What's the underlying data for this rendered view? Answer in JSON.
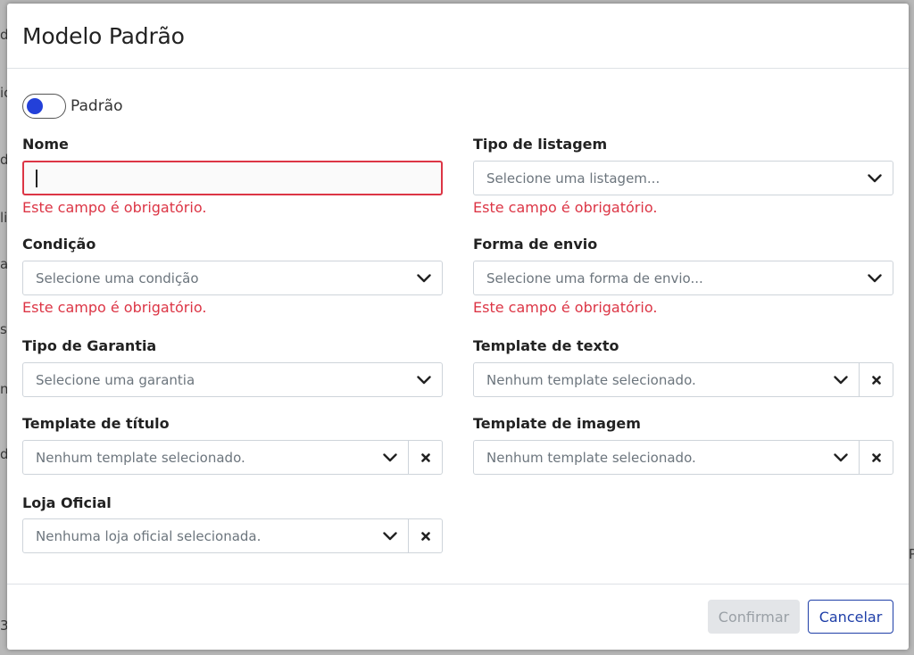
{
  "modal": {
    "title": "Modelo Padrão",
    "toggle_label": "Padrão",
    "toggle_on": false
  },
  "fields": {
    "nome": {
      "label": "Nome",
      "value": "",
      "error": "Este campo é obrigatório."
    },
    "tipo_listagem": {
      "label": "Tipo de listagem",
      "placeholder": "Selecione uma listagem...",
      "error": "Este campo é obrigatório."
    },
    "condicao": {
      "label": "Condição",
      "placeholder": "Selecione uma condição",
      "error": "Este campo é obrigatório."
    },
    "forma_envio": {
      "label": "Forma de envio",
      "placeholder": "Selecione uma forma de envio...",
      "error": "Este campo é obrigatório."
    },
    "tipo_garantia": {
      "label": "Tipo de Garantia",
      "placeholder": "Selecione uma garantia"
    },
    "template_texto": {
      "label": "Template de texto",
      "placeholder": "Nenhum template selecionado."
    },
    "template_titulo": {
      "label": "Template de título",
      "placeholder": "Nenhum template selecionado."
    },
    "template_imagem": {
      "label": "Template de imagem",
      "placeholder": "Nenhum template selecionado."
    },
    "loja_oficial": {
      "label": "Loja Oficial",
      "placeholder": "Nenhuma loja oficial selecionada."
    }
  },
  "footer": {
    "confirm_label": "Confirmar",
    "cancel_label": "Cancelar"
  },
  "colors": {
    "accent": "#2340d9",
    "error": "#dc3545",
    "cancel_border": "#1f3fa8"
  },
  "icons": {
    "dropdown": "chevron-down-icon",
    "clear": "close-icon"
  }
}
